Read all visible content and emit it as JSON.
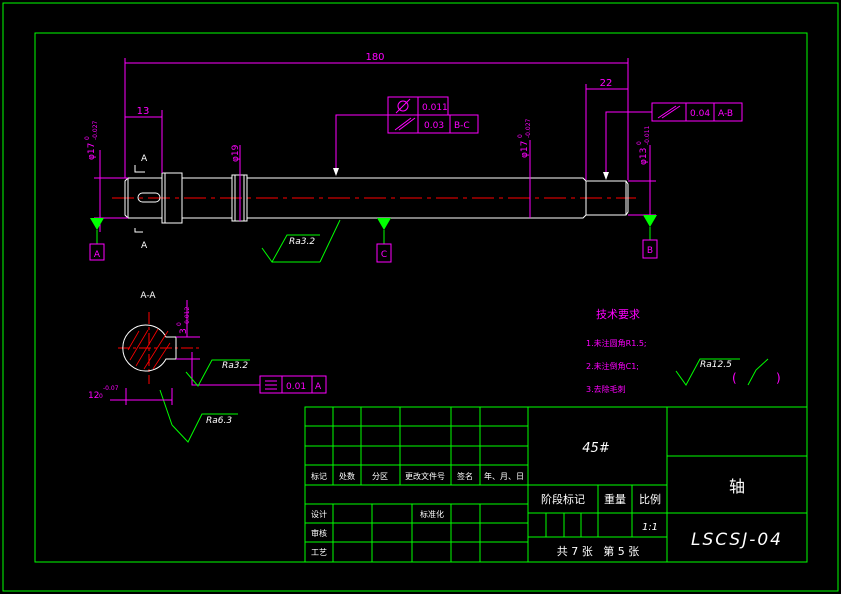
{
  "drawing": {
    "dims": {
      "overall_length": "180",
      "left_step": "13",
      "right_step": "22",
      "left_dia_main": "φ17",
      "left_dia_tol": "-0.027",
      "left_dia_zero": "0",
      "dia_collar": "φ19",
      "mid_dia_main": "φ17",
      "mid_dia_tol": "-0.027",
      "mid_dia_zero": "0",
      "right_dia_main": "φ13",
      "right_dia_tol": "-0.011",
      "right_dia_zero": "0"
    },
    "section_marks": {
      "top": "A",
      "bottom": "A",
      "view_label": "A-A"
    },
    "tolerance_frames": {
      "upper_val": "0.011",
      "lower_val": "0.03",
      "lower_datum": "B-C",
      "right_val": "0.04",
      "right_datum": "A-B",
      "section_val": "0.01",
      "section_datum": "A"
    },
    "datums": {
      "left": "A",
      "center": "C",
      "right": "B"
    },
    "roughness": {
      "shaft": "Ra3.2",
      "keyway": "Ra3.2",
      "section": "Ra6.3",
      "general": "Ra12.5"
    },
    "section_dims": {
      "keyway_depth": "3",
      "keyway_depth_zero": "0",
      "keyway_depth_tol": "-0.012",
      "keyway_width": "12",
      "keyway_width_zero": "0",
      "keyway_width_tol": "-0.07"
    },
    "tech_req": {
      "title": "技术要求",
      "items": [
        "1.未注圆角R1.5;",
        "2.未注倒角C1;",
        "3.去除毛刺"
      ]
    },
    "general_finish_paren_open": "(",
    "general_finish_paren_close": ")"
  },
  "title_block": {
    "material": "45#",
    "part_name": "轴",
    "drawing_no": "LSCSJ-04",
    "headers": [
      "标记",
      "处数",
      "分区",
      "更改文件号",
      "签名",
      "年、月、日"
    ],
    "stage_label": "阶段标记",
    "weight_label": "重量",
    "scale_label": "比例",
    "scale_value": "1:1",
    "design": "设计",
    "standardization": "标准化",
    "review": "审核",
    "process": "工艺",
    "sheets": "共 7 张   第 5 张"
  },
  "colors": {
    "border": "#00ff00",
    "outline": "#ffffff",
    "dimension": "#ff00ff",
    "centerline": "#ff0000",
    "table_text": "#ffffff"
  }
}
